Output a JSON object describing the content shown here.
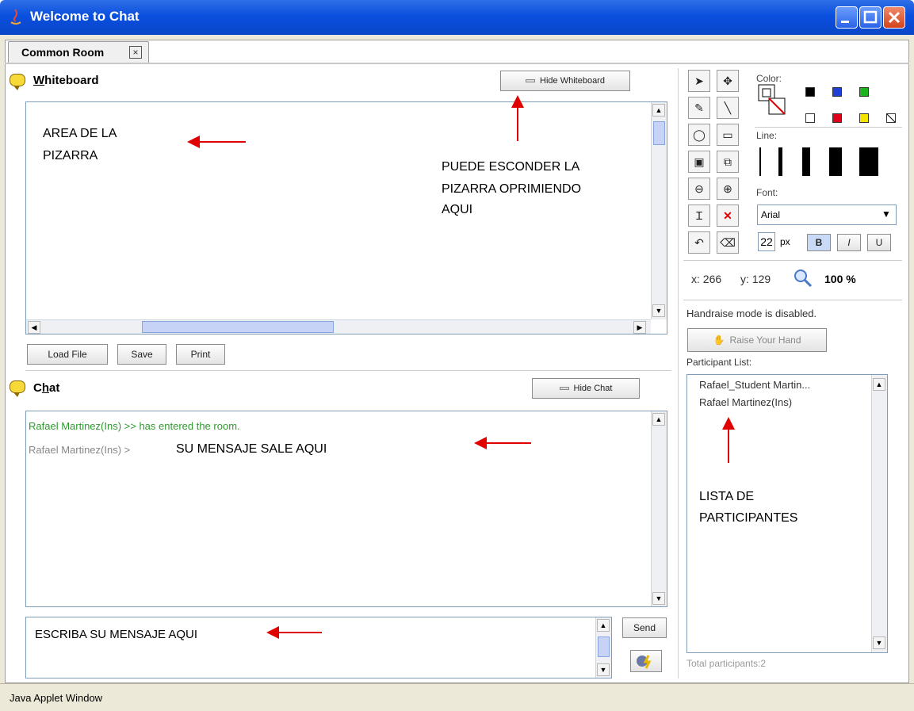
{
  "window": {
    "title": "Welcome to Chat"
  },
  "tab": {
    "label": "Common Room",
    "close": "×"
  },
  "whiteboard": {
    "title_first": "W",
    "title_rest": "hiteboard",
    "hide_button": "Hide Whiteboard",
    "load_button": "Load File",
    "save_button": "Save",
    "print_button": "Print",
    "annotation_area_1": "AREA DE LA",
    "annotation_area_2": "PIZARRA",
    "annotation_hide_1": "PUEDE ESCONDER LA",
    "annotation_hide_2": "PIZARRA OPRIMIENDO",
    "annotation_hide_3": "AQUI"
  },
  "chat": {
    "title_first": "C",
    "title_mid": "h",
    "title_rest": "at",
    "hide_button": "Hide Chat",
    "messages": [
      {
        "text": "Rafael Martinez(Ins) >> has entered the room.",
        "color": "#2e9a2e"
      },
      {
        "sender": "Rafael Martinez(Ins) >",
        "text": "SU MENSAJE SALE AQUI",
        "color": "#888888"
      }
    ],
    "input_text": "ESCRIBA SU MENSAJE AQUI",
    "send_button": "Send"
  },
  "tools": {
    "color_label": "Color:",
    "line_label": "Line:",
    "font_label": "Font:",
    "font_value": "Arial",
    "size_value": "22",
    "size_unit": "px",
    "bold": "B",
    "italic": "I",
    "underline": "U",
    "coord_x": "x: 266",
    "coord_y": "y: 129",
    "zoom": "100 %",
    "palette_top": [
      "#000000",
      "#1e3fd8",
      "#1cb41c"
    ],
    "palette_bottom": [
      "#ffffff",
      "#e0001a",
      "#f2e400",
      "none"
    ]
  },
  "handraise": {
    "status": "Handraise mode is disabled.",
    "button": "Raise Your Hand"
  },
  "participants": {
    "label": "Participant List:",
    "items": [
      "Rafael_Student Martin...",
      "Rafael Martinez(Ins)"
    ],
    "annotation_1": "LISTA DE",
    "annotation_2": "PARTICIPANTES",
    "total": "Total participants:2"
  },
  "status_bar": {
    "text": "Java Applet Window"
  }
}
